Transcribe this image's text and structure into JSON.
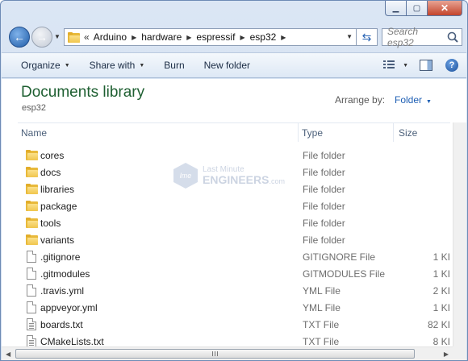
{
  "window": {
    "min_glyph": "▁",
    "max_glyph": "▢",
    "close_glyph": "✕"
  },
  "address": {
    "overflow": "«",
    "crumbs": [
      "Arduino",
      "hardware",
      "espressif",
      "esp32"
    ]
  },
  "search": {
    "placeholder": "Search esp32"
  },
  "toolbar": {
    "organize": "Organize",
    "share_with": "Share with",
    "burn": "Burn",
    "new_folder": "New folder"
  },
  "library": {
    "title": "Documents library",
    "subtitle": "esp32",
    "arrange_label": "Arrange by:",
    "arrange_value": "Folder"
  },
  "columns": {
    "name": "Name",
    "type": "Type",
    "size": "Size"
  },
  "files": [
    {
      "name": "cores",
      "type": "File folder",
      "size": "",
      "icon": "folder"
    },
    {
      "name": "docs",
      "type": "File folder",
      "size": "",
      "icon": "folder"
    },
    {
      "name": "libraries",
      "type": "File folder",
      "size": "",
      "icon": "folder"
    },
    {
      "name": "package",
      "type": "File folder",
      "size": "",
      "icon": "folder"
    },
    {
      "name": "tools",
      "type": "File folder",
      "size": "",
      "icon": "folder"
    },
    {
      "name": "variants",
      "type": "File folder",
      "size": "",
      "icon": "folder"
    },
    {
      "name": ".gitignore",
      "type": "GITIGNORE File",
      "size": "1 KI",
      "icon": "file"
    },
    {
      "name": ".gitmodules",
      "type": "GITMODULES File",
      "size": "1 KI",
      "icon": "file"
    },
    {
      "name": ".travis.yml",
      "type": "YML File",
      "size": "2 KI",
      "icon": "file"
    },
    {
      "name": "appveyor.yml",
      "type": "YML File",
      "size": "1 KI",
      "icon": "file"
    },
    {
      "name": "boards.txt",
      "type": "TXT File",
      "size": "82 KI",
      "icon": "txt"
    },
    {
      "name": "CMakeLists.txt",
      "type": "TXT File",
      "size": "8 KI",
      "icon": "txt"
    }
  ],
  "watermark": {
    "top": "Last Minute",
    "bottom": "ENGINEERS",
    "suffix": ".com",
    "logo": "lme"
  }
}
